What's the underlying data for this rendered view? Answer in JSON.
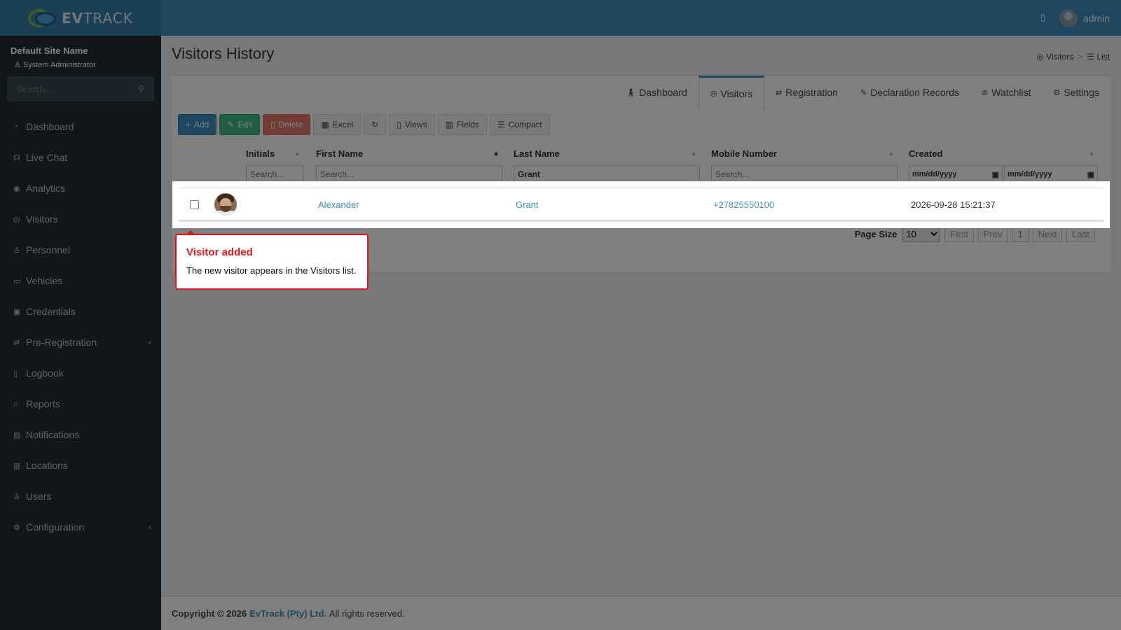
{
  "app": {
    "logo_bold": "EV",
    "logo_thin": "TRACK"
  },
  "topbar": {
    "user": "admin"
  },
  "sidebar": {
    "site_name": "Default Site Name",
    "role": "System Administrator",
    "search_placeholder": "Search...",
    "items": [
      {
        "label": "Dashboard"
      },
      {
        "label": "Live Chat"
      },
      {
        "label": "Analytics"
      },
      {
        "label": "Visitors"
      },
      {
        "label": "Personnel"
      },
      {
        "label": "Vehicles"
      },
      {
        "label": "Credentials"
      },
      {
        "label": "Pre-Registration"
      },
      {
        "label": "Logbook"
      },
      {
        "label": "Reports"
      },
      {
        "label": "Notifications"
      },
      {
        "label": "Locations"
      },
      {
        "label": "Users"
      },
      {
        "label": "Configuration"
      }
    ]
  },
  "page": {
    "title": "Visitors History",
    "breadcrumb": {
      "parent": "Visitors",
      "sep": ">",
      "current": "List"
    }
  },
  "tabs": [
    {
      "label": "Dashboard"
    },
    {
      "label": "Visitors"
    },
    {
      "label": "Registration"
    },
    {
      "label": "Declaration Records"
    },
    {
      "label": "Watchlist"
    },
    {
      "label": "Settings"
    }
  ],
  "toolbar": {
    "add": "Add",
    "edit": "Edit",
    "delete": "Delete",
    "excel": "Excel",
    "views": "Views",
    "fields": "Fields",
    "compact": "Compact"
  },
  "grid": {
    "columns": [
      "Initials",
      "First Name",
      "Last Name",
      "Mobile Number",
      "Created"
    ],
    "filters": {
      "initials_placeholder": "Search...",
      "first_name_placeholder": "Search...",
      "last_name_value": "Grant",
      "mobile_placeholder": "Search...",
      "created_from": "mm/dd/yyyy",
      "created_to": "mm/dd/yyyy"
    },
    "rows": [
      {
        "first_name": "Alexander",
        "last_name": "Grant",
        "mobile": "+27825550100",
        "created": "2026-09-28 15:21:37"
      }
    ]
  },
  "pager": {
    "label": "Page Size",
    "size": "10",
    "first": "First",
    "prev": "Prev",
    "current": "1",
    "next": "Next",
    "last": "Last"
  },
  "callout": {
    "title": "Visitor added",
    "body": "The new visitor appears in the Visitors list."
  },
  "footer": {
    "copyright": "Copyright © 2026",
    "company": "EvTrack (Pty) Ltd.",
    "rights": "All rights reserved."
  },
  "colors": {
    "brand": "#3c8dbc",
    "sidebar": "#222d32",
    "callout_accent": "#e0151b"
  }
}
